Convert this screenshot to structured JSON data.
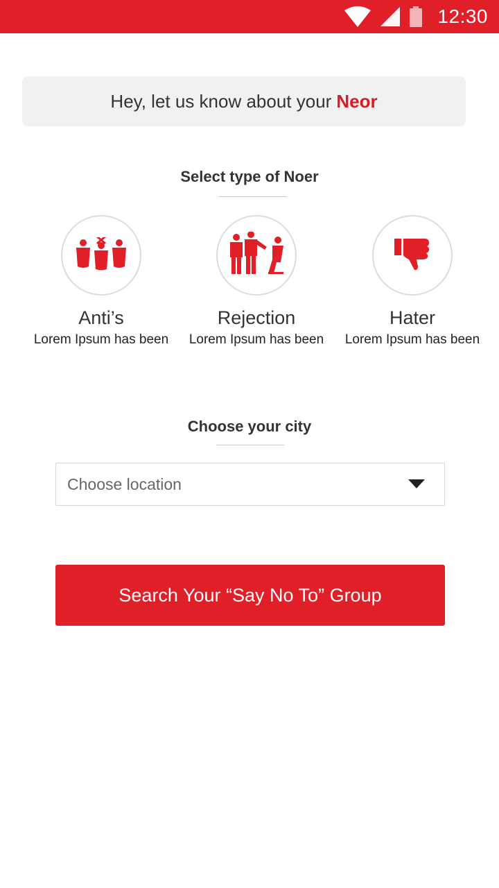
{
  "status_bar": {
    "time": "12:30",
    "icons": [
      "wifi-icon",
      "cell-signal-icon",
      "battery-icon"
    ],
    "background_color": "#e01f28"
  },
  "banner": {
    "text": "Hey, let us know about your",
    "highlight": "Neor",
    "highlight_color": "#d51d26"
  },
  "type_section": {
    "heading": "Select type of Noer",
    "options": [
      {
        "icon": "anti-group-icon",
        "title": "Anti’s",
        "description": "Lorem Ipsum has been"
      },
      {
        "icon": "rejection-people-icon",
        "title": "Rejection",
        "description": "Lorem Ipsum has been"
      },
      {
        "icon": "thumbs-down-icon",
        "title": "Hater",
        "description": "Lorem Ipsum has been"
      }
    ]
  },
  "city_section": {
    "heading": "Choose your city",
    "select_placeholder": "Choose location",
    "dropdown_icon": "caret-down-icon"
  },
  "search_button": {
    "label": "Search Your “Say No To” Group",
    "color": "#e01f28"
  }
}
